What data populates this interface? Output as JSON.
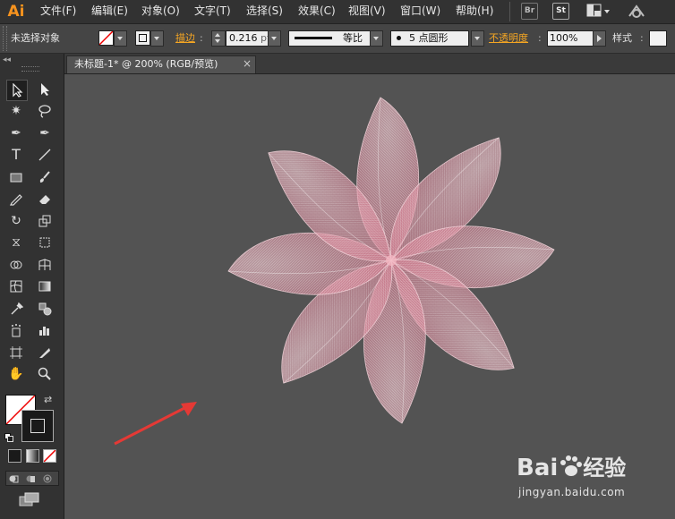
{
  "app": {
    "logo": "Ai"
  },
  "menu": [
    "文件(F)",
    "编辑(E)",
    "对象(O)",
    "文字(T)",
    "选择(S)",
    "效果(C)",
    "视图(V)",
    "窗口(W)",
    "帮助(H)"
  ],
  "top_buttons": {
    "bridge": "Br",
    "stock": "St"
  },
  "options": {
    "selection": "未选择对象",
    "stroke_label": "描边",
    "stroke_value": "0.216",
    "stroke_unit": "pt",
    "profile_label": "等比",
    "brush_label": "5 点圆形",
    "opacity_label": "不透明度",
    "opacity_value": "100%",
    "style_label": "样式"
  },
  "document": {
    "tab_title": "未标题-1* @ 200% (RGB/预览)",
    "close": "×"
  },
  "watermark": {
    "brand_left": "Bai",
    "brand_right": "经验",
    "url": "jingyan.baidu.com"
  },
  "colors": {
    "accent": "#f7931e",
    "petal": "#e9a3b2",
    "annotation_arrow": "#e53935",
    "link_label": "#f5a623"
  }
}
